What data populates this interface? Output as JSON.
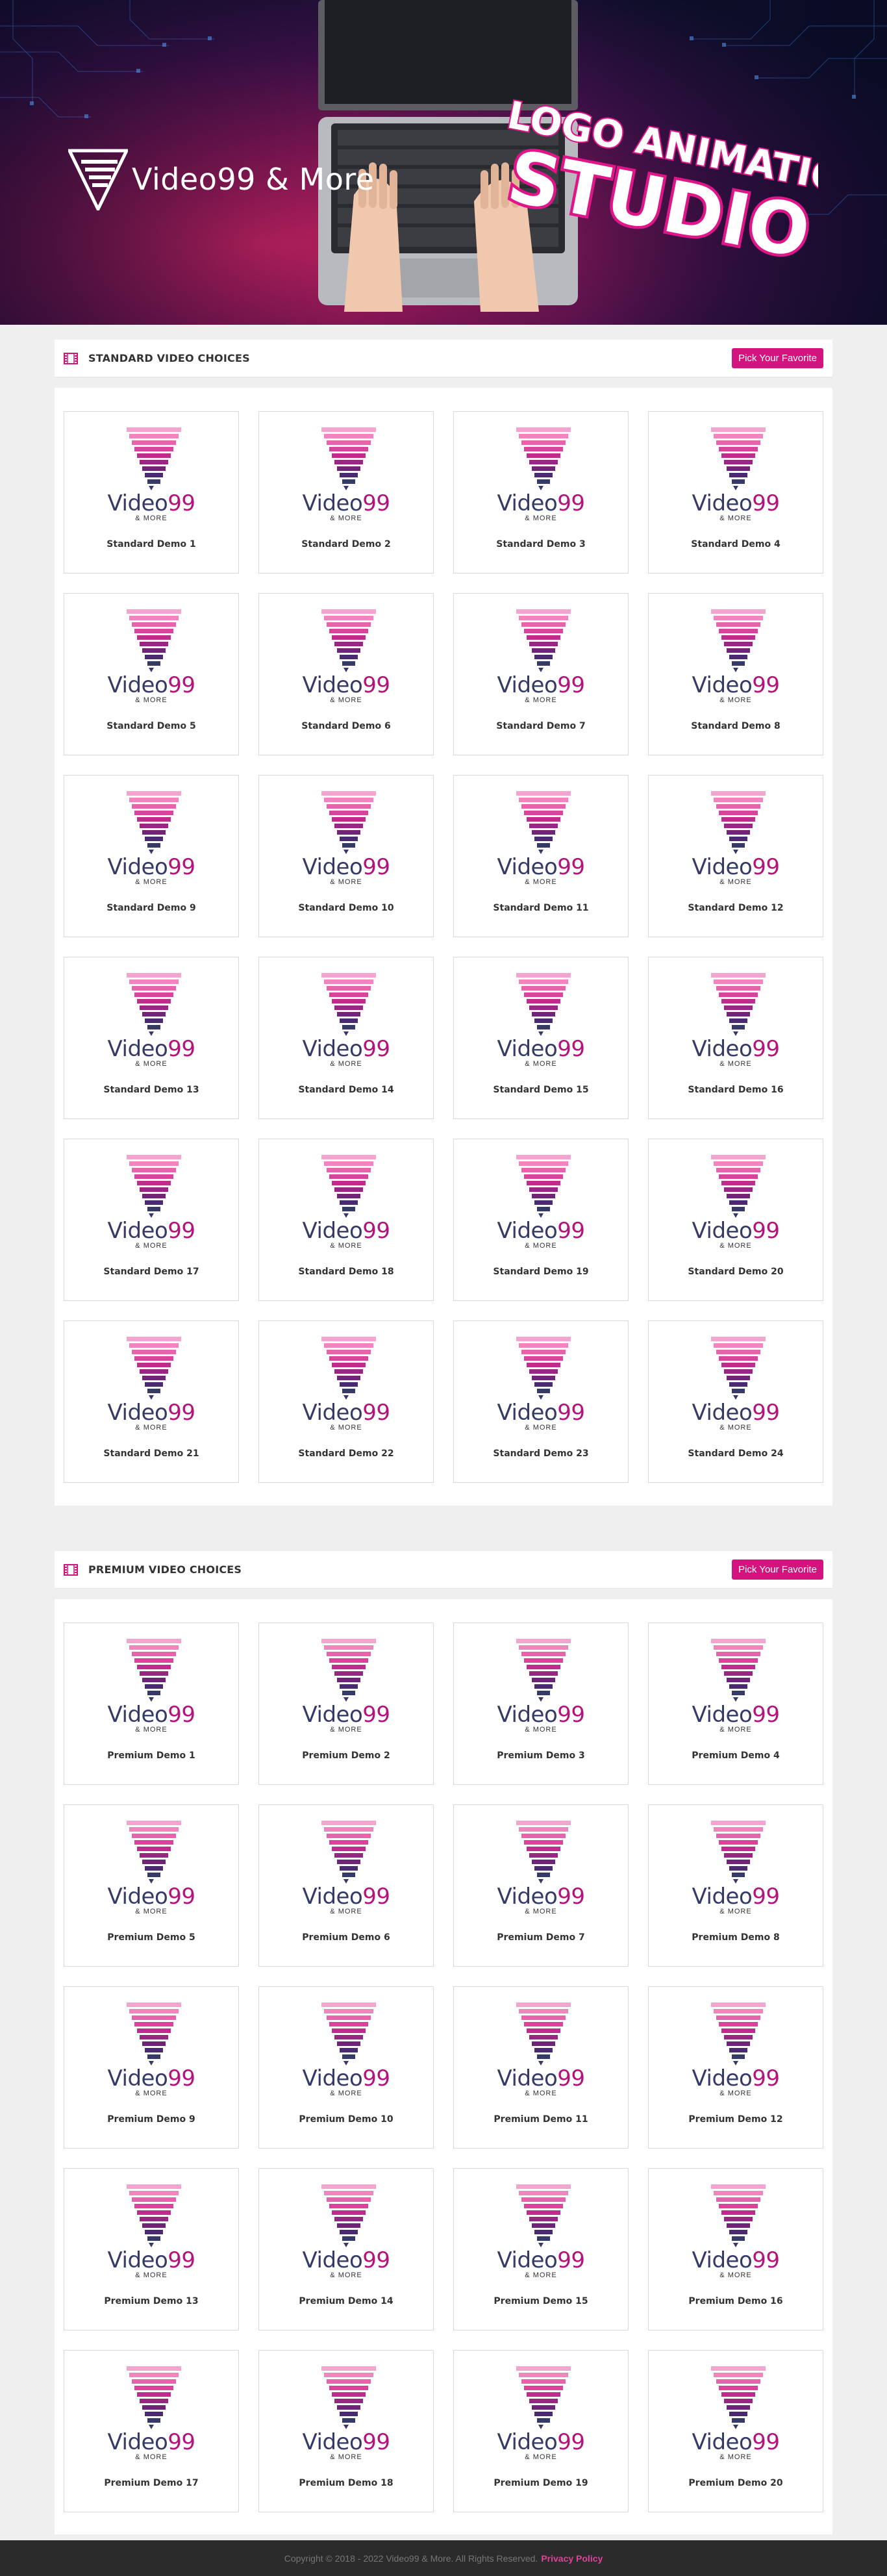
{
  "hero": {
    "brand": "Video99 & More",
    "headline_1": "LOGO ANIMATION",
    "headline_2": "STUDIO"
  },
  "brand_card": {
    "word": "Video",
    "number": "99",
    "sub": "& MORE"
  },
  "colors": {
    "accent": "#d4147e",
    "brand_pink": "#b3137b",
    "brand_navy": "#353a66",
    "footer_bg": "#2b2b2b"
  },
  "standard": {
    "title": "STANDARD VIDEO CHOICES",
    "button": "Pick Your Favorite",
    "icon": "film-icon",
    "items": [
      "Standard Demo 1",
      "Standard Demo 2",
      "Standard Demo 3",
      "Standard Demo 4",
      "Standard Demo 5",
      "Standard Demo 6",
      "Standard Demo 7",
      "Standard Demo 8",
      "Standard Demo 9",
      "Standard Demo 10",
      "Standard Demo 11",
      "Standard Demo 12",
      "Standard Demo 13",
      "Standard Demo 14",
      "Standard Demo 15",
      "Standard Demo 16",
      "Standard Demo 17",
      "Standard Demo 18",
      "Standard Demo 19",
      "Standard Demo 20",
      "Standard Demo 21",
      "Standard Demo 22",
      "Standard Demo 23",
      "Standard Demo 24"
    ]
  },
  "premium": {
    "title": "PREMIUM VIDEO CHOICES",
    "button": "Pick Your Favorite",
    "icon": "film-icon",
    "items": [
      "Premium Demo 1",
      "Premium Demo 2",
      "Premium Demo 3",
      "Premium Demo 4",
      "Premium Demo 5",
      "Premium Demo 6",
      "Premium Demo 7",
      "Premium Demo 8",
      "Premium Demo 9",
      "Premium Demo 10",
      "Premium Demo 11",
      "Premium Demo 12",
      "Premium Demo 13",
      "Premium Demo 14",
      "Premium Demo 15",
      "Premium Demo 16",
      "Premium Demo 17",
      "Premium Demo 18",
      "Premium Demo 19",
      "Premium Demo 20"
    ]
  },
  "footer": {
    "copyright": "Copyright © 2018 - 2022 Video99 & More. All Rights Reserved.",
    "privacy": "Privacy Policy"
  }
}
